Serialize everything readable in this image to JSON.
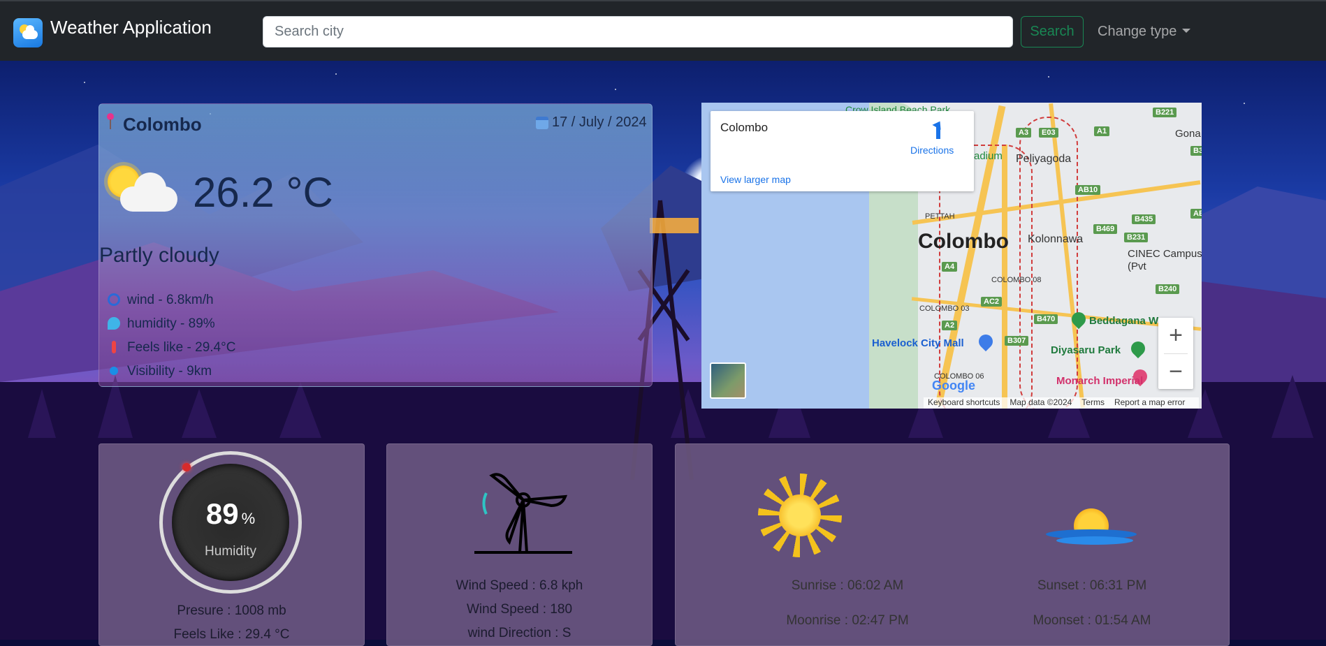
{
  "app": {
    "title": "Weather Application",
    "search_placeholder": "Search city",
    "search_button": "Search",
    "change_type_label": "Change type"
  },
  "current": {
    "city": "Colombo",
    "date": "17 / July / 2024",
    "temperature": "26.2 °C",
    "condition": "Partly cloudy",
    "condition_icon": "partly-cloudy-icon",
    "stats": {
      "wind": "wind - 6.8km/h",
      "humidity": "humidity - 89%",
      "feels_like": "Feels like - 29.4°C",
      "visibility": "Visibility - 9km"
    }
  },
  "map": {
    "place_title": "Colombo",
    "directions_label": "Directions",
    "view_larger_label": "View larger map",
    "center_label": "Colombo",
    "labels": {
      "peliyagoda": "Peliyagoda",
      "kolonnawa": "Kolonnawa",
      "pettah": "PETTAH",
      "colombo_08": "COLOMBO 08",
      "colombo_03": "COLOMBO 03",
      "colombo_06": "COLOMBO 06",
      "cinec": "CINEC Campus (Pvt",
      "gona": "Gona",
      "stadium": "adium",
      "crow_island": "Crow Island Beach Park"
    },
    "pois": {
      "havelock": "Havelock City Mall",
      "diyasaru": "Diyasaru Park",
      "beddagana": "Beddagana W",
      "monarch": "Monarch Imperial"
    },
    "badges": [
      "B221",
      "A3",
      "E03",
      "A1",
      "AB10",
      "B435",
      "B469",
      "B231",
      "B240",
      "A4",
      "AC2",
      "A2",
      "B470",
      "B307",
      "B3",
      "AB"
    ],
    "footer": {
      "shortcuts": "Keyboard shortcuts",
      "data": "Map data ©2024",
      "terms": "Terms",
      "report": "Report a map error"
    },
    "google": "Google",
    "zoom_in": "+",
    "zoom_out": "−"
  },
  "humidity_panel": {
    "value": "89",
    "unit": "%",
    "label": "Humidity",
    "pressure": "Presure : 1008 mb",
    "feels_like": "Feels Like : 29.4 °C"
  },
  "wind_panel": {
    "speed_kph": "Wind Speed : 6.8 kph",
    "speed_degree": "Wind Speed : 180",
    "direction": "wind Direction : S"
  },
  "astro_panel": {
    "sunrise": "Sunrise : 06:02 AM",
    "sunset": "Sunset : 06:31 PM",
    "moonrise": "Moonrise : 02:47 PM",
    "moonset": "Moonset : 01:54 AM"
  },
  "colors": {
    "navbar": "#212529",
    "search_accent": "#198754",
    "pin": "#e8338b",
    "humidity_marker": "#d72b2b"
  }
}
